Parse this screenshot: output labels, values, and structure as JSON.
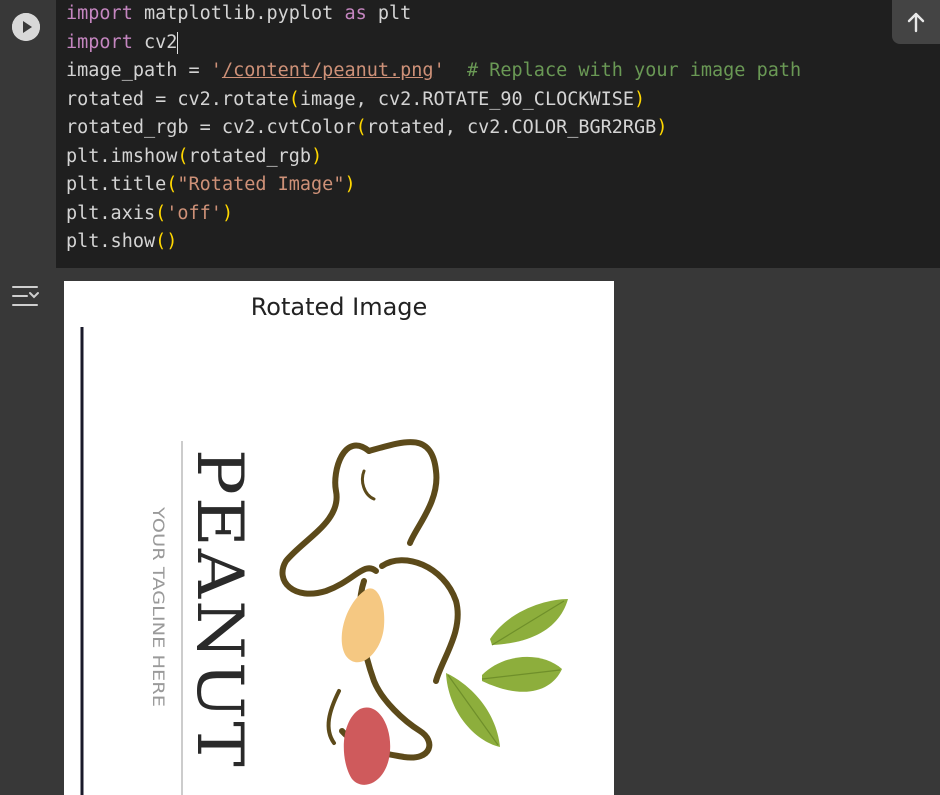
{
  "editor": {
    "lines": [
      [
        {
          "t": "import",
          "c": "kw"
        },
        {
          "t": " matplotlib.pyplot "
        },
        {
          "t": "as",
          "c": "kw"
        },
        {
          "t": " plt"
        }
      ],
      [
        {
          "t": "import",
          "c": "kw"
        },
        {
          "t": " cv2"
        }
      ],
      [
        {
          "t": "image_path = "
        },
        {
          "t": "'",
          "c": "str"
        },
        {
          "t": "/content/peanut.png",
          "c": "str link"
        },
        {
          "t": "'",
          "c": "str"
        },
        {
          "t": "  "
        },
        {
          "t": "# Replace with your image path",
          "c": "cm"
        }
      ],
      [
        {
          "t": "rotated = cv2.rotate"
        },
        {
          "t": "(",
          "c": "br1"
        },
        {
          "t": "image, cv2.ROTATE_90_CLOCKWISE"
        },
        {
          "t": ")",
          "c": "br1"
        }
      ],
      [
        {
          "t": "rotated_rgb = cv2.cvtColor"
        },
        {
          "t": "(",
          "c": "br1"
        },
        {
          "t": "rotated, cv2.COLOR_BGR2RGB"
        },
        {
          "t": ")",
          "c": "br1"
        }
      ],
      [
        {
          "t": "plt.imshow"
        },
        {
          "t": "(",
          "c": "br1"
        },
        {
          "t": "rotated_rgb"
        },
        {
          "t": ")",
          "c": "br1"
        }
      ],
      [
        {
          "t": "plt.title"
        },
        {
          "t": "(",
          "c": "br1"
        },
        {
          "t": "\"Rotated Image\"",
          "c": "str"
        },
        {
          "t": ")",
          "c": "br1"
        }
      ],
      [
        {
          "t": "plt.axis"
        },
        {
          "t": "(",
          "c": "br1"
        },
        {
          "t": "'off'",
          "c": "str"
        },
        {
          "t": ")",
          "c": "br1"
        }
      ],
      [
        {
          "t": "plt.show"
        },
        {
          "t": "()",
          "c": "br1"
        }
      ]
    ]
  },
  "icons": {
    "run": "play-icon",
    "scroll_up": "arrow-up-icon",
    "output_menu": "output-actions-icon"
  },
  "figure": {
    "title": "Rotated Image",
    "logo_word": "PEANUT",
    "logo_tagline": "YOUR TAGLINE HERE"
  },
  "colors": {
    "editor_bg": "#1f1f1f",
    "keyword": "#c586c0",
    "string": "#ce9178",
    "comment": "#6a9955",
    "bracket": "#ffd700"
  }
}
